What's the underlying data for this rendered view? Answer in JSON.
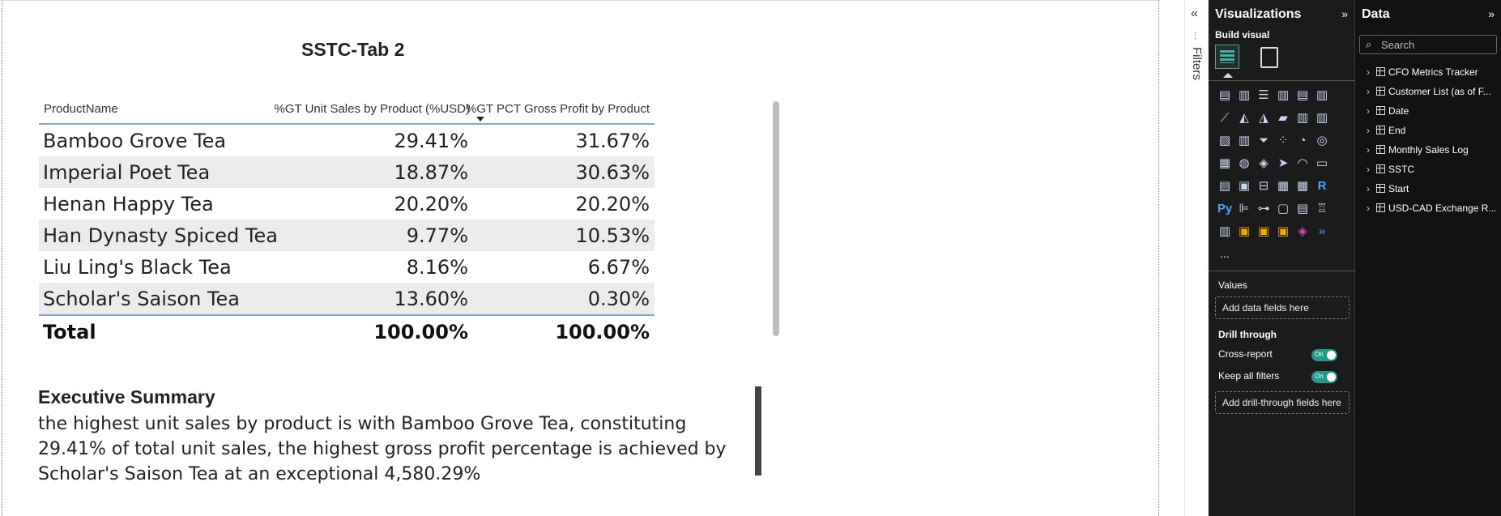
{
  "report": {
    "title": "SSTC-Tab 2",
    "table": {
      "headers": [
        "ProductName",
        "%GT Unit Sales by Product (%USD)",
        "%GT PCT Gross Profit by Product"
      ],
      "rows": [
        {
          "name": "Bamboo Grove Tea",
          "unit": "29.41%",
          "gp": "31.67%"
        },
        {
          "name": "Imperial Poet Tea",
          "unit": "18.87%",
          "gp": "30.63%"
        },
        {
          "name": "Henan Happy Tea",
          "unit": "20.20%",
          "gp": "20.20%"
        },
        {
          "name": "Han Dynasty Spiced Tea",
          "unit": "9.77%",
          "gp": "10.53%"
        },
        {
          "name": "Liu Ling's Black Tea",
          "unit": "8.16%",
          "gp": "6.67%"
        },
        {
          "name": "Scholar's Saison Tea",
          "unit": "13.60%",
          "gp": "0.30%"
        }
      ],
      "total": {
        "name": "Total",
        "unit": "100.00%",
        "gp": "100.00%"
      }
    },
    "summary": {
      "title": "Executive Summary",
      "text": "the highest unit sales by product is with Bamboo Grove Tea, constituting 29.41% of total unit sales, the highest gross profit percentage is achieved by Scholar's Saison Tea at an exceptional 4,580.29%"
    }
  },
  "filters": {
    "label": "Filters",
    "collapse_glyph": "«"
  },
  "visualizations": {
    "title": "Visualizations",
    "expand_glyph": "»",
    "build_visual_label": "Build visual",
    "more_label": "...",
    "values_label": "Values",
    "add_data_fields": "Add data fields here",
    "drill_through_label": "Drill through",
    "cross_report_label": "Cross-report",
    "keep_all_filters_label": "Keep all filters",
    "toggle_on": "On",
    "add_drill_through": "Add drill-through fields here"
  },
  "data_pane": {
    "title": "Data",
    "expand_glyph": "»",
    "search_placeholder": "Search",
    "tables": [
      "CFO Metrics Tracker",
      "Customer List (as of F...",
      "Date",
      "End",
      "Monthly Sales Log",
      "SSTC",
      "Start",
      "USD-CAD Exchange R..."
    ]
  }
}
